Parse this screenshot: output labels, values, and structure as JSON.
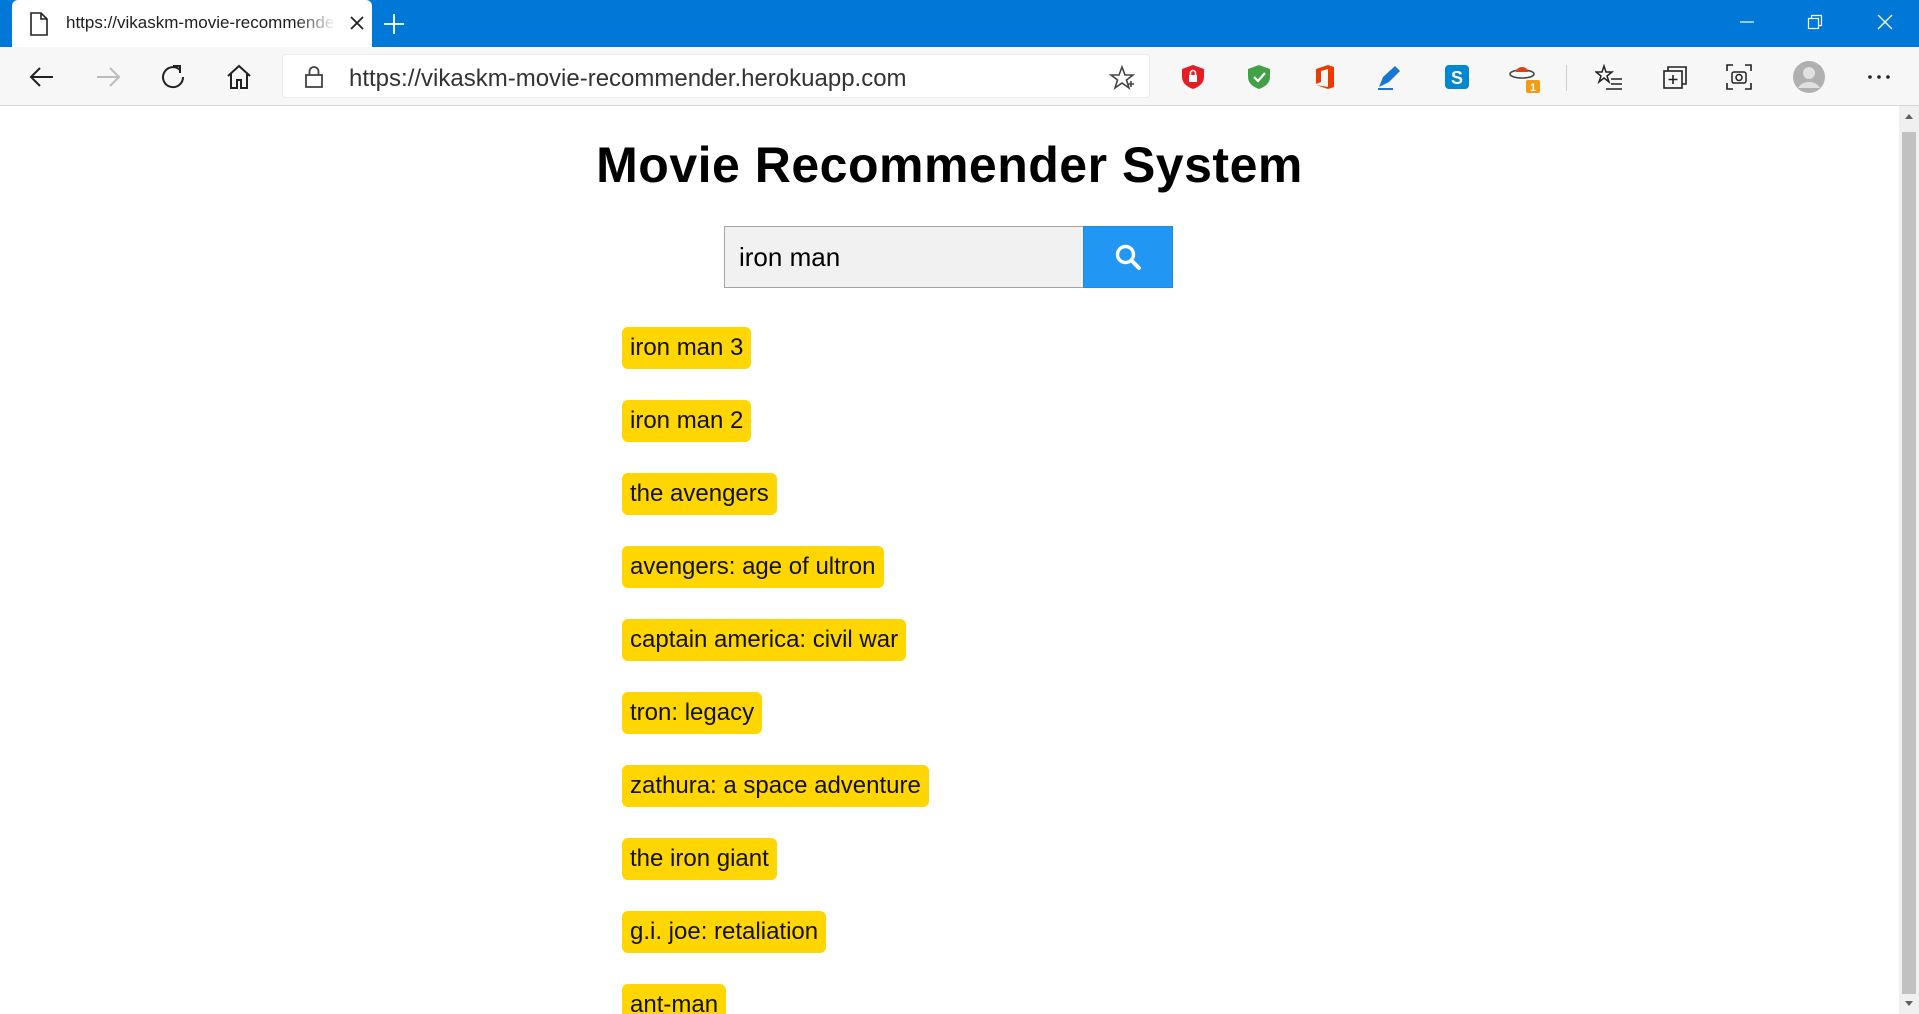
{
  "browser": {
    "tab_title": "https://vikaskm-movie-recommender.herokuapp.com",
    "url": "https://vikaskm-movie-recommender.herokuapp.com",
    "extension_badge": "1",
    "accent_color": "#0078d7"
  },
  "page": {
    "title": "Movie Recommender System",
    "search": {
      "value": "iron man",
      "button_icon": "search-icon",
      "button_color": "#2196f3"
    },
    "chip_color": "#ffd600",
    "results": [
      "iron man 3",
      "iron man 2",
      "the avengers",
      "avengers: age of ultron",
      "captain america: civil war",
      "tron: legacy",
      "zathura: a space adventure",
      "the iron giant",
      "g.i. joe: retaliation",
      "ant-man"
    ]
  }
}
